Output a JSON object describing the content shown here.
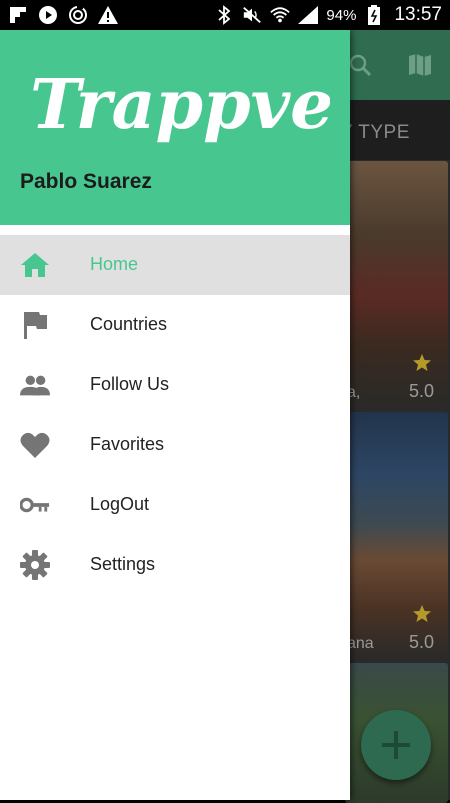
{
  "status_bar": {
    "battery": "94%",
    "time": "13:57",
    "icons": [
      "flipboard-icon",
      "play-icon",
      "sync-icon",
      "warning-icon",
      "bluetooth-icon",
      "mute-icon",
      "wifi-icon",
      "signal-icon",
      "battery-icon"
    ]
  },
  "drawer": {
    "app_name": "Trappvellers",
    "user_name": "Pablo Suarez",
    "menu": [
      {
        "label": "Home",
        "icon": "home-icon",
        "active": true
      },
      {
        "label": "Countries",
        "icon": "flag-icon",
        "active": false
      },
      {
        "label": "Follow Us",
        "icon": "people-icon",
        "active": false
      },
      {
        "label": "Favorites",
        "icon": "heart-icon",
        "active": false
      },
      {
        "label": "LogOut",
        "icon": "key-icon",
        "active": false
      },
      {
        "label": "Settings",
        "icon": "gear-icon",
        "active": false
      }
    ]
  },
  "background": {
    "tab_partial": "Y TYPE",
    "cards": [
      {
        "rating": "5.0",
        "partial_text": "a,"
      },
      {
        "rating": "5.0",
        "partial_text": "ana"
      }
    ],
    "fab_icon": "plus-icon"
  },
  "colors": {
    "accent": "#47c78f",
    "toolbar_dim": "#2f6c50",
    "star": "#b59a2a"
  }
}
